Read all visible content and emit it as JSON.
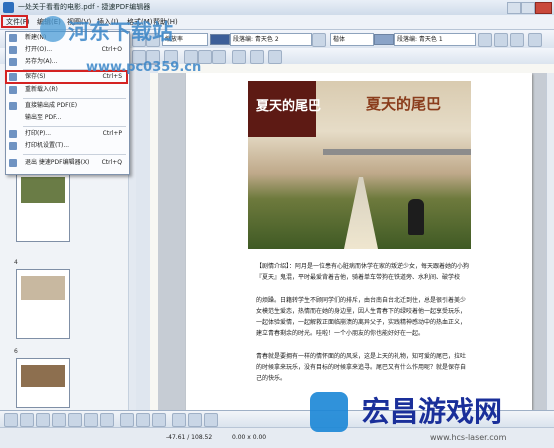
{
  "window": {
    "title": "一处关于看看的电影.pdf - 捷速PDF编辑器"
  },
  "menubar": {
    "items": [
      "文件(F)",
      "编辑(E)",
      "视图(V)",
      "插入(I)",
      "格式(M)",
      "帮助(H)"
    ]
  },
  "toolbar": {
    "zoom_value": "缩放率",
    "style_para": "段落编: 青天色 2",
    "font_value": "楷体",
    "style_para2": "段落编: 青天色 1"
  },
  "file_menu": {
    "items": [
      {
        "label": "新建(N)",
        "shortcut": ""
      },
      {
        "label": "打开(O)...",
        "shortcut": "Ctrl+O"
      },
      {
        "label": "另存为(A)...",
        "shortcut": ""
      },
      {
        "label": "保存(S)",
        "shortcut": "Ctrl+S"
      },
      {
        "label": "重新载入(R)",
        "shortcut": ""
      },
      {
        "label": "直接输出成 PDF(E)",
        "shortcut": ""
      },
      {
        "label": "输出至 PDF...",
        "shortcut": ""
      },
      {
        "label": "打印(P)...",
        "shortcut": "Ctrl+P"
      },
      {
        "label": "打印机设置(T)...",
        "shortcut": ""
      },
      {
        "label": "退出 捷速PDF编辑器(X)",
        "shortcut": "Ctrl+Q"
      }
    ]
  },
  "sidebar": {
    "page_numbers": [
      "4",
      "5",
      "6"
    ]
  },
  "document": {
    "poster_title": "夏天的尾巴",
    "poster_title_right": "夏天的尾巴",
    "paragraphs": [
      "【剧情介绍】：阿月是一位患有心脏病而休学在家的叛逆少女，每天跟着她的小狗『夏天』鬼混，平时最爱背着吉他，骑着单车带狗在铁道旁、水利间、破学校",
      "的烦躁。日籍转学生不顾同学们的排斥，由台南自台北迁到住，总是很引着美少女模范生爱恋，热情而在她的身边里，因人生青春下的绿咬着他一起享受玩乐，一起体验爱情，一起解救正面临崩溃的离异父子，实践精神感动中的热血正义，建立青春剩余的时光。哇啦！一个小朋友的你也能好好在一起。",
      "青春就是要拥有一样的情怀面的的风采，这是上天的礼物，知可爱的尾巴，拉吐的时候拿来玩乐，没有目标的时候拿来追寻。尾巴又有什么作用呢？就是保存自己的快乐。"
    ]
  },
  "statusbar": {
    "coords": "-47.61 / 108.52",
    "size": "0.00 x 0.00"
  },
  "watermarks": {
    "top_brand": "河东下载站",
    "top_url": "www.pc0359.cn",
    "bottom_brand": "宏昌游戏网",
    "bottom_url": "www.hcs-laser.com"
  },
  "colors": {
    "highlight_red": "#d42222",
    "accent_blue": "#2d6fbd"
  }
}
